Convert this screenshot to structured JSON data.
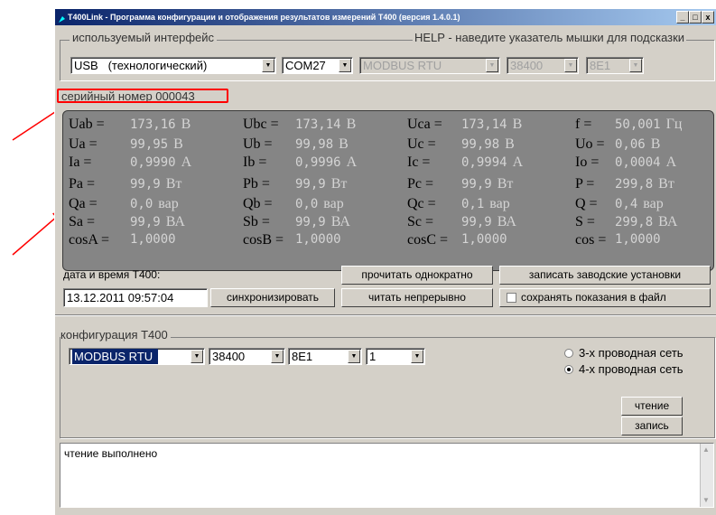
{
  "window": {
    "title": "T400Link - Программа конфигурации и отображения результатов измерений T400 (версия 1.4.0.1)",
    "min_glyph": "_",
    "max_glyph": "□",
    "close_glyph": "x"
  },
  "interface": {
    "group_label": "используемый интерфейс",
    "help_text": "HELP - наведите указатель мышки для подсказки",
    "type_value": "USB   (технологический)",
    "port_value": "COM27",
    "protocol_value": "MODBUS RTU",
    "baud_value": "38400",
    "format_value": "8E1"
  },
  "serial": {
    "label": "серийный номер 000043"
  },
  "measurements": {
    "rows": [
      [
        {
          "n": "Uab =",
          "v": "173,16",
          "u": "В"
        },
        {
          "n": "Ubc =",
          "v": "173,14",
          "u": "В"
        },
        {
          "n": "Uca =",
          "v": "173,14",
          "u": "В"
        },
        {
          "n": "f =",
          "v": "50,001",
          "u": "Гц"
        }
      ],
      [
        {
          "n": "Ua =",
          "v": "99,95",
          "u": "В"
        },
        {
          "n": "Ub =",
          "v": "99,98",
          "u": "В"
        },
        {
          "n": "Uc =",
          "v": "99,98",
          "u": "В"
        },
        {
          "n": "Uo =",
          "v": "0,06",
          "u": "В"
        }
      ],
      [
        {
          "n": "Ia =",
          "v": "0,9990",
          "u": "А"
        },
        {
          "n": "Ib =",
          "v": "0,9996",
          "u": "А"
        },
        {
          "n": "Ic =",
          "v": "0,9994",
          "u": "А"
        },
        {
          "n": "Io =",
          "v": "0,0004",
          "u": "А"
        }
      ],
      [
        {
          "n": "Pa =",
          "v": "99,9",
          "u": "Вт"
        },
        {
          "n": "Pb =",
          "v": "99,9",
          "u": "Вт"
        },
        {
          "n": "Pc =",
          "v": "99,9",
          "u": "Вт"
        },
        {
          "n": "P =",
          "v": "299,8",
          "u": "Вт"
        }
      ],
      [
        {
          "n": "Qa =",
          "v": "0,0",
          "u": "вар"
        },
        {
          "n": "Qb =",
          "v": "0,0",
          "u": "вар"
        },
        {
          "n": "Qc =",
          "v": "0,1",
          "u": "вар"
        },
        {
          "n": "Q =",
          "v": "0,4",
          "u": "вар"
        }
      ],
      [
        {
          "n": "Sa =",
          "v": "99,9",
          "u": "ВА"
        },
        {
          "n": "Sb =",
          "v": "99,9",
          "u": "ВА"
        },
        {
          "n": "Sc =",
          "v": "99,9",
          "u": "ВА"
        },
        {
          "n": "S =",
          "v": "299,8",
          "u": "ВА"
        }
      ],
      [
        {
          "n": "cosA =",
          "v": "1,0000",
          "u": ""
        },
        {
          "n": "cosB =",
          "v": "1,0000",
          "u": ""
        },
        {
          "n": "cosC =",
          "v": "1,0000",
          "u": ""
        },
        {
          "n": "cos =",
          "v": "1,0000",
          "u": ""
        }
      ]
    ]
  },
  "datetime": {
    "label": "дата и время T400:",
    "value": "13.12.2011 09:57:04",
    "sync_button": "синхронизировать"
  },
  "actions": {
    "read_once": "прочитать однократно",
    "read_continuous": "читать непрерывно",
    "write_factory": "записать заводские установки",
    "save_to_file": "сохранять показания в файл"
  },
  "config": {
    "group_label": "конфигурация T400",
    "protocol_value": "MODBUS RTU",
    "baud_value": "38400",
    "format_value": "8E1",
    "address_value": "1",
    "network_3wire": "3-х проводная сеть",
    "network_4wire": "4-х проводная сеть",
    "selected_network": "4-х проводная сеть",
    "read_button": "чтение",
    "write_button": "запись"
  },
  "log": {
    "text": "чтение выполнено"
  },
  "colors": {
    "annotation_red": "#ff0000",
    "panel_gray": "#858585",
    "value_text": "#d4d4d4",
    "window_face": "#d4d0c8",
    "title_blue": "#0a246a"
  }
}
